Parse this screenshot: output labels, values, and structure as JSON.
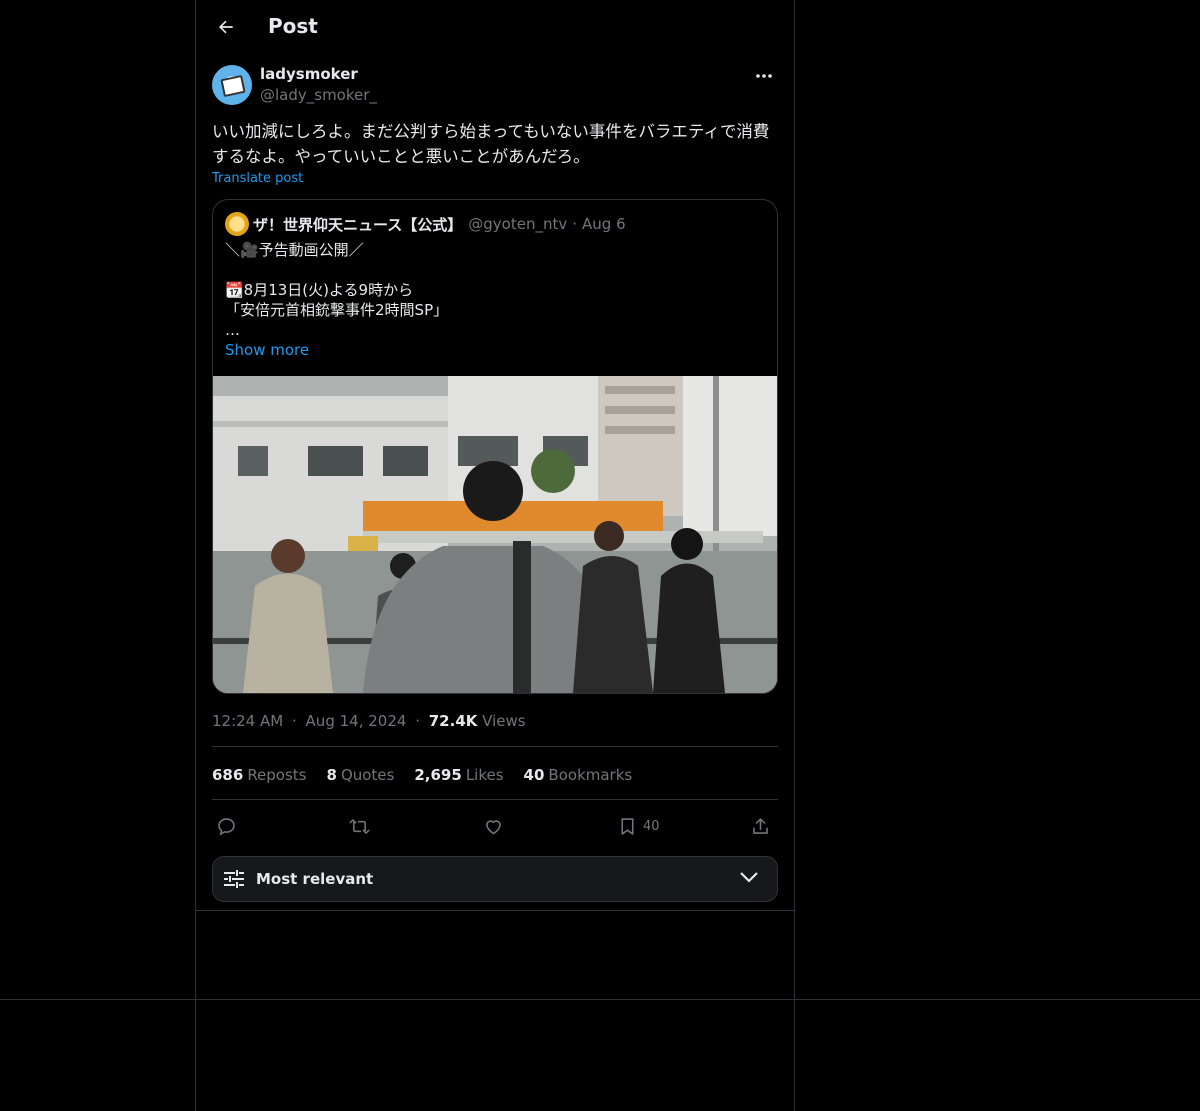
{
  "header": {
    "title": "Post"
  },
  "post": {
    "author_name": "ladysmoker",
    "author_handle": "@lady_smoker_",
    "text_line1": "いい加減にしろよ。まだ公判すら始まってもいない事件をバラエティで消費",
    "text_line2": "するなよ。やっていいことと悪いことがあんだろ。",
    "translate_label": "Translate post",
    "time": "12:24 AM",
    "date": "Aug 14, 2024",
    "views_count": "72.4K",
    "views_label": "Views"
  },
  "quote": {
    "name": "ザ！世界仰天ニュース【公式】",
    "handle": "@gyoten_ntv",
    "separator": "·",
    "date": "Aug 6",
    "line1": "＼🎥予告動画公開／",
    "line2": "",
    "line3": "📆8月13日(火)よる9時から",
    "line4": "「安倍元首相銃撃事件2時間SP」",
    "line5": "…",
    "show_more": "Show more"
  },
  "stats": {
    "reposts_count": "686",
    "reposts_label": "Reposts",
    "quotes_count": "8",
    "quotes_label": "Quotes",
    "likes_count": "2,695",
    "likes_label": "Likes",
    "bookmarks_count": "40",
    "bookmarks_label": "Bookmarks"
  },
  "actions": {
    "reply_icon": "reply-icon",
    "repost_icon": "repost-icon",
    "like_icon": "heart-icon",
    "bookmark_icon": "bookmark-icon",
    "bookmark_count": "40",
    "share_icon": "share-icon"
  },
  "sort": {
    "label": "Most relevant"
  },
  "colors": {
    "accent": "#1d9bf0",
    "muted": "#71767b",
    "text": "#e7e9ea",
    "border": "#2f3336",
    "background": "#000000"
  }
}
